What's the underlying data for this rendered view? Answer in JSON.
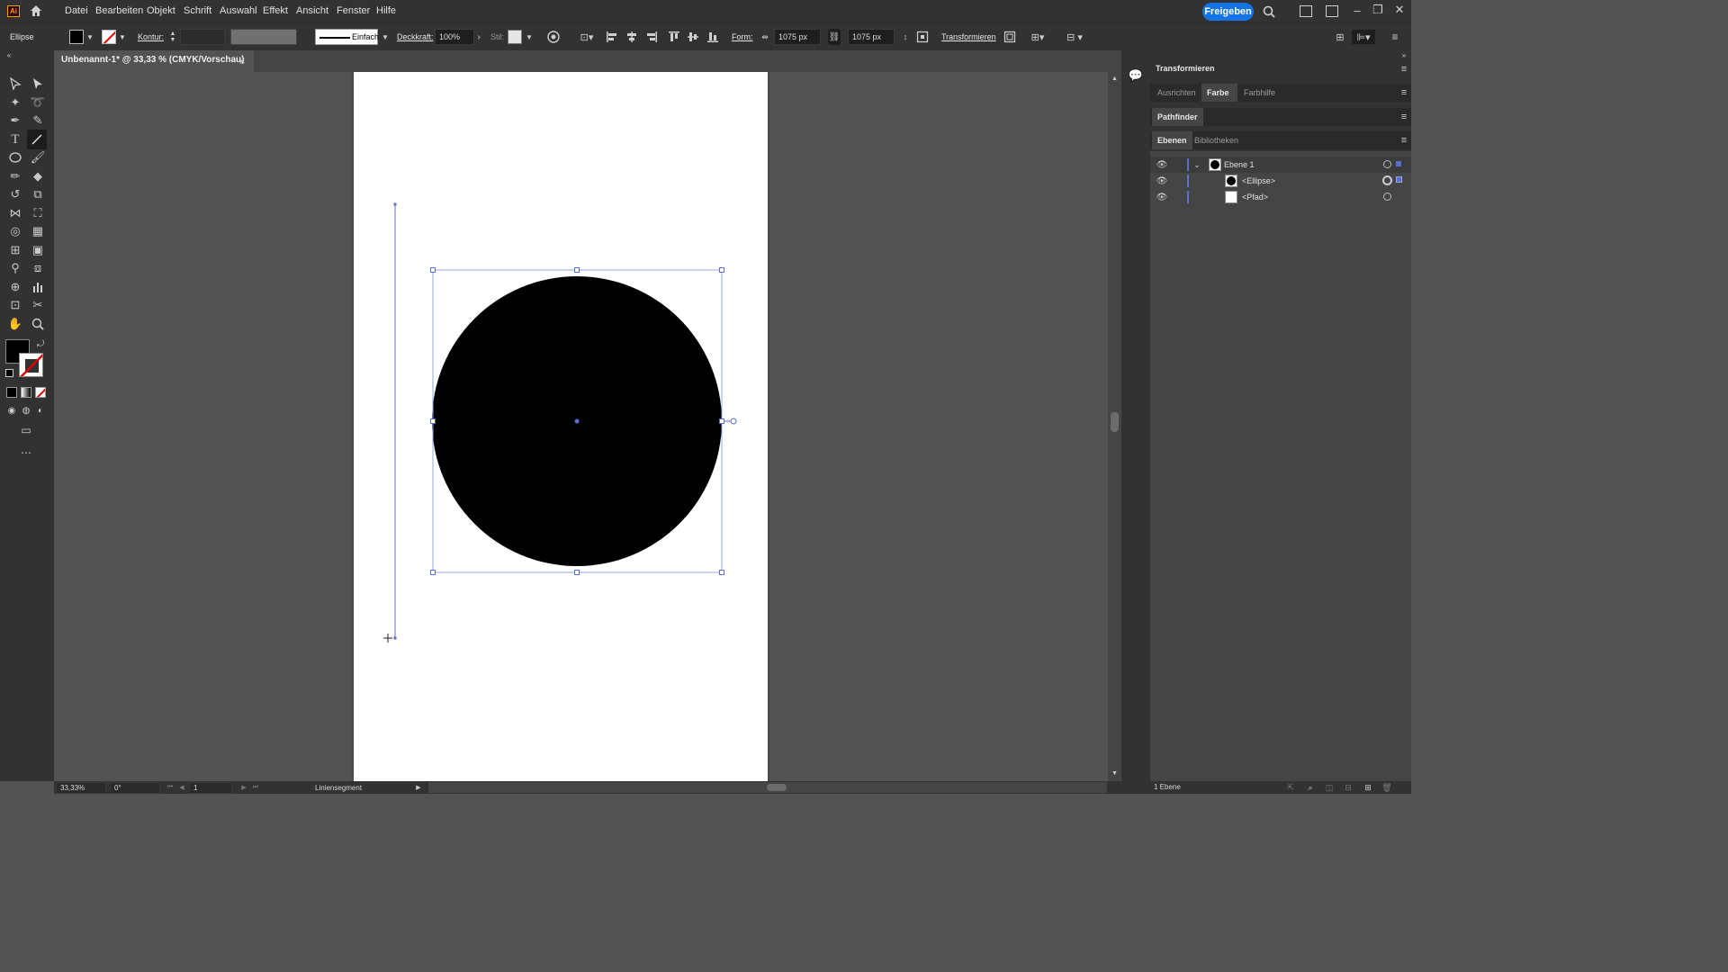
{
  "app": {
    "logo": "Ai"
  },
  "menu": [
    "Datei",
    "Bearbeiten",
    "Objekt",
    "Schrift",
    "Auswahl",
    "Effekt",
    "Ansicht",
    "Fenster",
    "Hilfe"
  ],
  "share_button": "Freigeben",
  "options": {
    "tool_name": "Ellipse",
    "stroke_label": "Kontur:",
    "stroke_profile": "Einfach",
    "opacity_label": "Deckkraft:",
    "opacity_value": "100%",
    "style_label": "Stil:",
    "shape_label": "Form:",
    "width_value": "1075 px",
    "height_value": "1075 px",
    "transform_label": "Transformieren"
  },
  "document_tab": {
    "title": "Unbenannt-1* @ 33,33 % (CMYK/Vorschau)",
    "close": "×"
  },
  "status": {
    "zoom": "33,33%",
    "rotation": "0°",
    "artboard": "1",
    "tool_info": "Liniensegment"
  },
  "panels": {
    "transform_header": "Transformieren",
    "tabs1": [
      "Ausrichten",
      "Farbe",
      "Farbhilfe"
    ],
    "tabs1_active": "Farbe",
    "pathfinder": "Pathfinder",
    "tabs2": [
      "Ebenen",
      "Bibliotheken"
    ],
    "tabs2_active": "Ebenen",
    "layers": [
      {
        "name": "Ebene 1"
      },
      {
        "name": "<Ellipse>"
      },
      {
        "name": "<Pfad>"
      }
    ],
    "layer_count": "1 Ebene"
  },
  "colors": {
    "selection": "#5b6ecf",
    "accent": "#1473e6",
    "fill": "#000000",
    "ui_dark": "#323232",
    "canvas_bg": "#535353"
  }
}
